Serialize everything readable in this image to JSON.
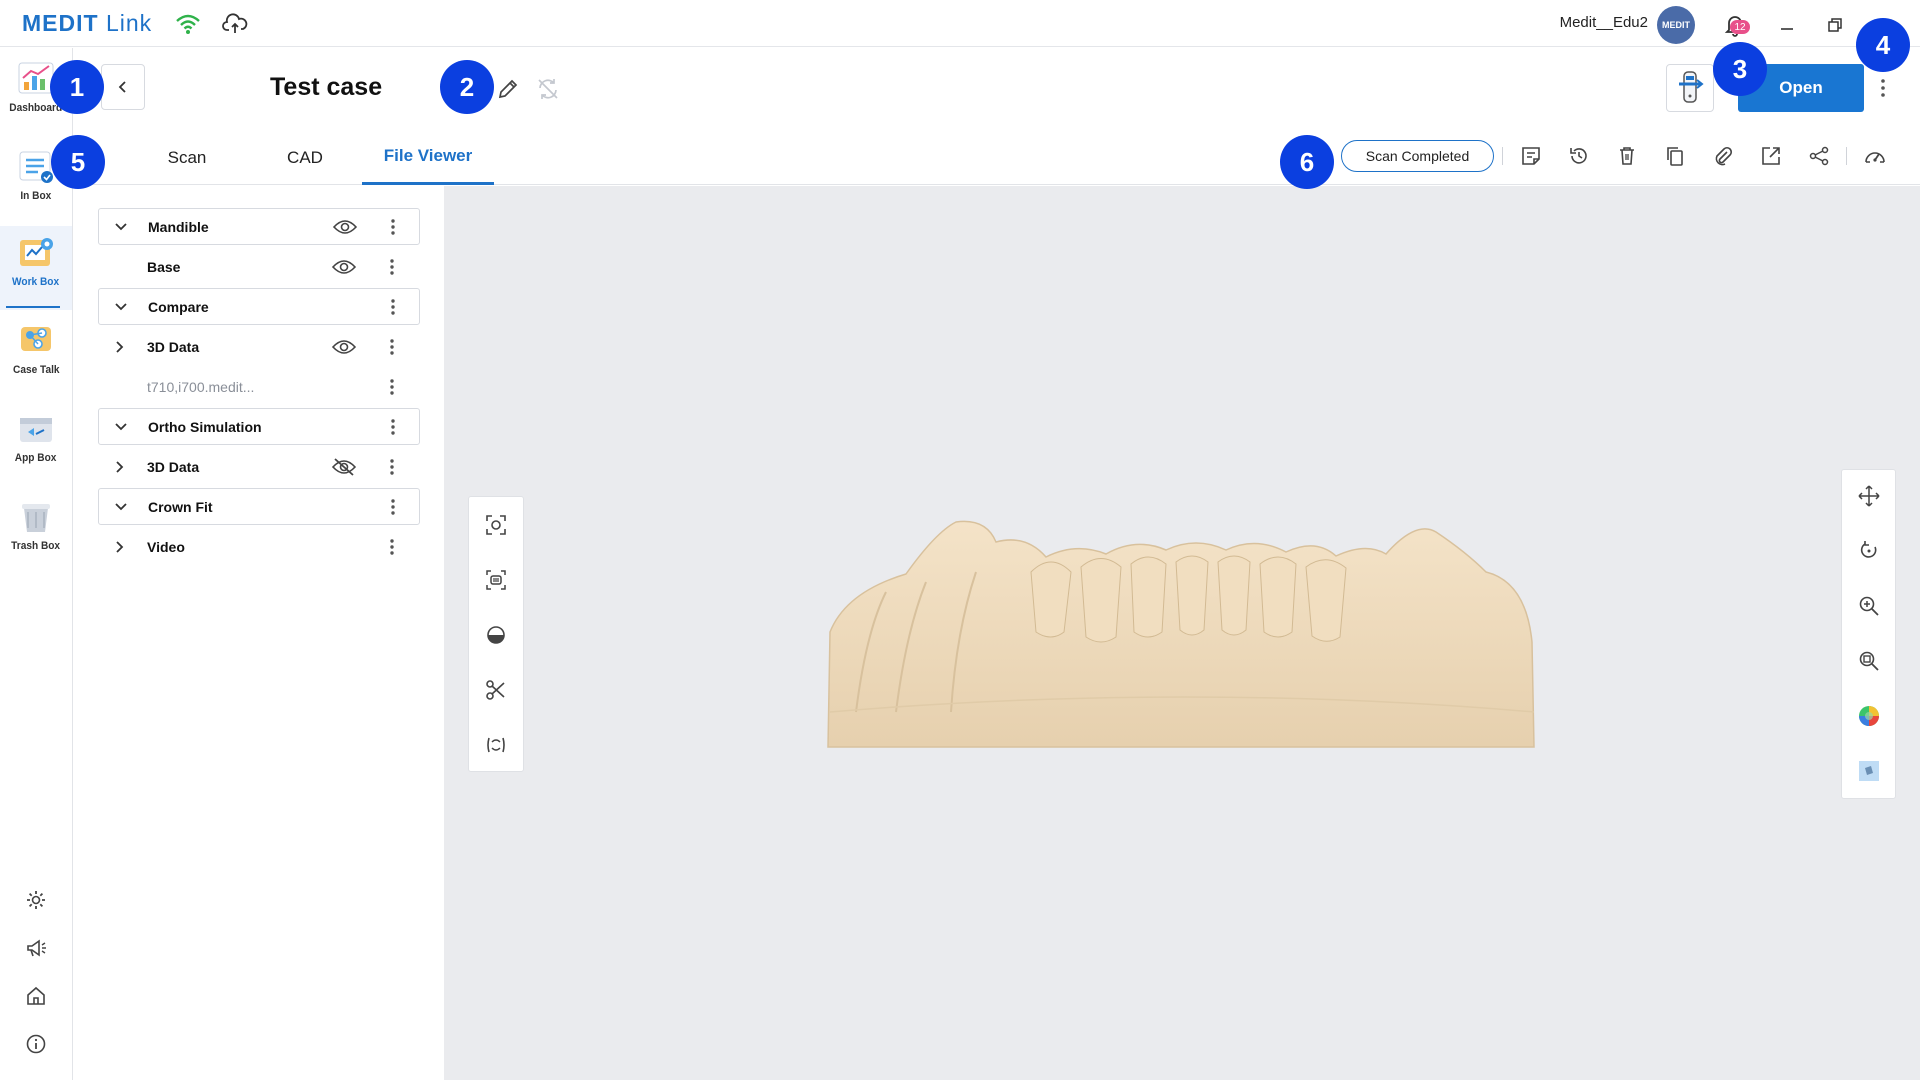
{
  "app": {
    "logo_main": "MEDIT",
    "logo_sub": "Link",
    "username": "Medit__Edu2",
    "avatar_text": "MEDIT",
    "notification_count": "12",
    "brand_color": "#1e72c8"
  },
  "sidebar": {
    "items": [
      {
        "label": "Dashboard",
        "icon": "dashboard-icon"
      },
      {
        "label": "In Box",
        "icon": "inbox-icon"
      },
      {
        "label": "Work Box",
        "icon": "workbox-icon",
        "active": true
      },
      {
        "label": "Case Talk",
        "icon": "casetalk-icon"
      },
      {
        "label": "App Box",
        "icon": "appbox-icon"
      },
      {
        "label": "Trash Box",
        "icon": "trash-icon"
      }
    ],
    "bottom_icons": [
      "settings-icon",
      "announcement-icon",
      "home-icon",
      "info-icon"
    ]
  },
  "header": {
    "case_title": "Test case",
    "open_label": "Open"
  },
  "tabs": [
    {
      "label": "Scan"
    },
    {
      "label": "CAD"
    },
    {
      "label": "File Viewer",
      "active": true
    }
  ],
  "status": {
    "label": "Scan Completed"
  },
  "toolbar_icons": [
    "note-icon",
    "history-icon",
    "delete-icon",
    "copy-icon",
    "attach-icon",
    "export-icon",
    "share-icon",
    "dashboard-gauge-icon"
  ],
  "tree": [
    {
      "name": "Mandible",
      "expandable": true,
      "expanded": true,
      "boxed": true,
      "eye": "visible"
    },
    {
      "name": "Base",
      "expandable": false,
      "boxed": false,
      "eye": "visible"
    },
    {
      "name": "Compare",
      "expandable": true,
      "expanded": true,
      "boxed": true,
      "eye": "none"
    },
    {
      "name": "3D Data",
      "expandable": true,
      "expanded": false,
      "boxed": false,
      "eye": "visible"
    },
    {
      "name": "t710,i700.medit...",
      "expandable": false,
      "boxed": false,
      "eye": "none",
      "muted": true
    },
    {
      "name": "Ortho Simulation",
      "expandable": true,
      "expanded": true,
      "boxed": true,
      "eye": "none"
    },
    {
      "name": "3D Data",
      "expandable": true,
      "expanded": false,
      "boxed": false,
      "eye": "hidden"
    },
    {
      "name": "Crown Fit",
      "expandable": true,
      "expanded": true,
      "boxed": true,
      "eye": "none"
    },
    {
      "name": "Video",
      "expandable": true,
      "expanded": false,
      "boxed": false,
      "eye": "none"
    }
  ],
  "viewer": {
    "left_tools": [
      "fit-view-icon",
      "capture-icon",
      "section-icon",
      "trim-icon",
      "occlusion-icon"
    ],
    "right_tools": [
      "pan-icon",
      "rotate-icon",
      "zoom-in-icon",
      "zoom-fit-icon",
      "color-map-icon",
      "texture-cube-icon"
    ]
  },
  "markers": [
    "1",
    "2",
    "3",
    "4",
    "5",
    "6"
  ]
}
